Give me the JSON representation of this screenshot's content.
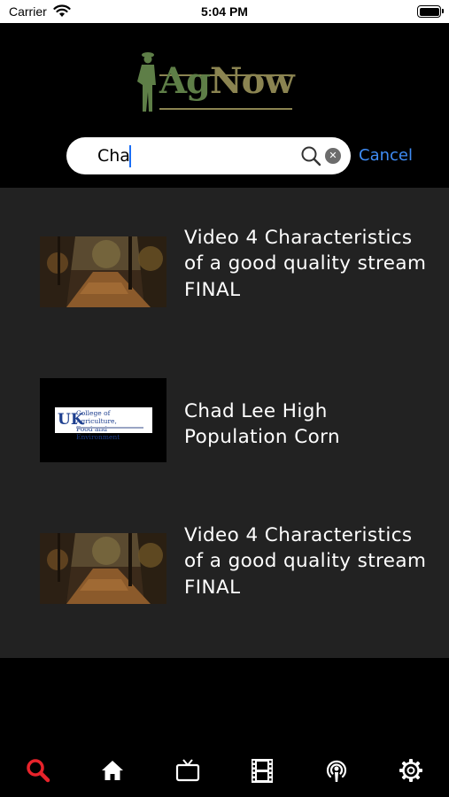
{
  "status_bar": {
    "carrier": "Carrier",
    "time": "5:04 PM"
  },
  "header": {
    "logo": {
      "part1": "Ag",
      "part2": "Now"
    },
    "search": {
      "value": "Cha",
      "placeholder": "Search"
    },
    "cancel_label": "Cancel"
  },
  "results": [
    {
      "title": "Video 4 Characteristics of a good quality stream FINAL",
      "thumbnail": "forest-path"
    },
    {
      "title": "Chad Lee High Population Corn",
      "thumbnail": "uk-logo"
    },
    {
      "title": "Video 4 Characteristics of a good quality stream FINAL",
      "thumbnail": "forest-path"
    }
  ],
  "uk_card": {
    "mark": "UK",
    "line1": "College of Agriculture,",
    "line2": "Food and Environment"
  },
  "tabbar": {
    "active_color": "#e8232b",
    "items": [
      {
        "icon": "search-icon",
        "active": true
      },
      {
        "icon": "home-icon",
        "active": false
      },
      {
        "icon": "tv-icon",
        "active": false
      },
      {
        "icon": "film-icon",
        "active": false
      },
      {
        "icon": "podcast-icon",
        "active": false
      },
      {
        "icon": "gear-icon",
        "active": false
      }
    ]
  }
}
